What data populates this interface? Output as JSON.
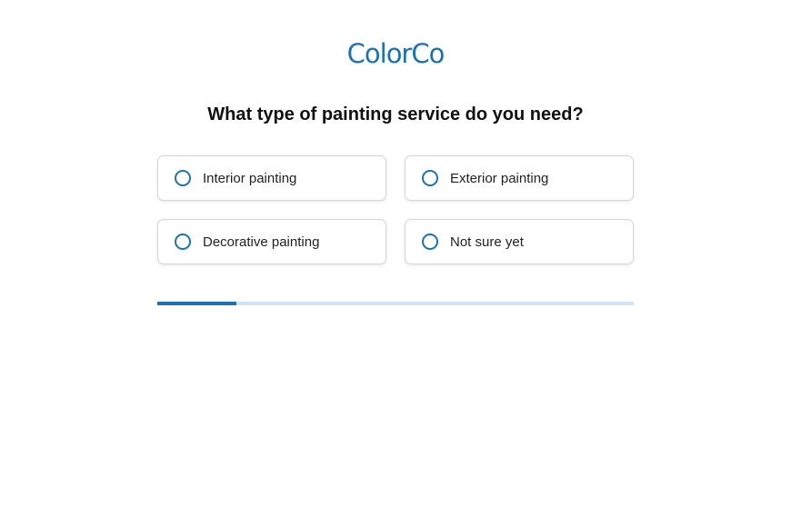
{
  "brand": {
    "logo_text": "ColorCo",
    "color": "#1a73b8"
  },
  "question": {
    "title": "What type of painting service do you need?"
  },
  "options": [
    {
      "label": "Interior painting",
      "selected": false
    },
    {
      "label": "Exterior painting",
      "selected": false
    },
    {
      "label": "Decorative painting",
      "selected": false
    },
    {
      "label": "Not sure yet",
      "selected": false
    }
  ],
  "progress": {
    "fraction": 0.166,
    "fill_color": "#1a73b8",
    "track_color": "#cfe3f2"
  }
}
